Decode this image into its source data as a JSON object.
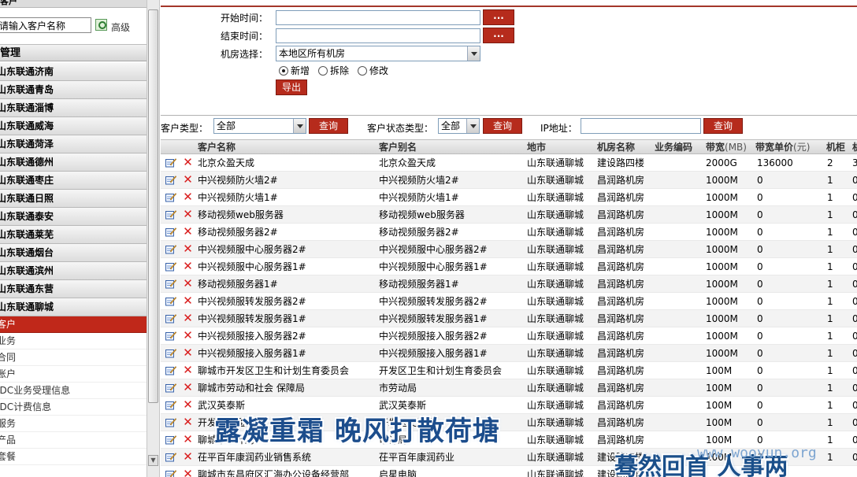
{
  "sidebar": {
    "header": "客户",
    "search_placeholder": "请输入客户名称",
    "advanced_label": "高级",
    "section_title": "管理",
    "cities": [
      "山东联通济南",
      "山东联通青岛",
      "山东联通淄博",
      "山东联通威海",
      "山东联通菏泽",
      "山东联通德州",
      "山东联通枣庄",
      "山东联通日照",
      "山东联通泰安",
      "山东联通莱芜",
      "山东联通烟台",
      "山东联通滨州",
      "山东联通东营",
      "山东联通聊城"
    ],
    "sub_items": [
      {
        "label": "客户",
        "active": true
      },
      {
        "label": "业务",
        "active": false
      },
      {
        "label": "合同",
        "active": false
      },
      {
        "label": "账户",
        "active": false
      },
      {
        "label": "IDC业务受理信息",
        "active": false
      },
      {
        "label": "IDC计费信息",
        "active": false
      },
      {
        "label": "服务",
        "active": false
      },
      {
        "label": "产品",
        "active": false
      },
      {
        "label": "套餐",
        "active": false
      }
    ]
  },
  "form": {
    "start_label": "开始时间：",
    "end_label": "结束时间：",
    "room_label": "机房选择：",
    "room_value": "本地区所有机房",
    "browse_label": "...",
    "radio_options": [
      {
        "label": "新增",
        "checked": true
      },
      {
        "label": "拆除",
        "checked": false
      },
      {
        "label": "修改",
        "checked": false
      }
    ],
    "export_label": "导出"
  },
  "filters": {
    "type_label": "客户类型：",
    "type_value": "全部",
    "status_label": "客户状态类型：",
    "status_value": "全部",
    "ip_label": "IP地址：",
    "query_label": "查询"
  },
  "table": {
    "headers": [
      "客户名称",
      "客户别名",
      "地市",
      "机房名称",
      "业务编码",
      "带宽",
      "带宽单价",
      "机柜",
      "机"
    ],
    "bandwidth_unit": "(MB)",
    "price_unit": "(元)",
    "rows": [
      [
        "北京众盈天成",
        "北京众盈天成",
        "山东联通聊城",
        "建设路四楼",
        "",
        "2000G",
        "136000",
        "2",
        "3"
      ],
      [
        "中兴视频防火墙2#",
        "中兴视频防火墙2#",
        "山东联通聊城",
        "昌润路机房",
        "",
        "1000M",
        "0",
        "1",
        "0"
      ],
      [
        "中兴视频防火墙1#",
        "中兴视频防火墙1#",
        "山东联通聊城",
        "昌润路机房",
        "",
        "1000M",
        "0",
        "1",
        "0"
      ],
      [
        "移动视频web服务器",
        "移动视频web服务器",
        "山东联通聊城",
        "昌润路机房",
        "",
        "1000M",
        "0",
        "1",
        "0"
      ],
      [
        "移动视频服务器2#",
        "移动视频服务器2#",
        "山东联通聊城",
        "昌润路机房",
        "",
        "1000M",
        "0",
        "1",
        "0"
      ],
      [
        "中兴视频服中心服务器2#",
        "中兴视频服中心服务器2#",
        "山东联通聊城",
        "昌润路机房",
        "",
        "1000M",
        "0",
        "1",
        "0"
      ],
      [
        "中兴视频服中心服务器1#",
        "中兴视频服中心服务器1#",
        "山东联通聊城",
        "昌润路机房",
        "",
        "1000M",
        "0",
        "1",
        "0"
      ],
      [
        "移动视频服务器1#",
        "移动视频服务器1#",
        "山东联通聊城",
        "昌润路机房",
        "",
        "1000M",
        "0",
        "1",
        "0"
      ],
      [
        "中兴视频服转发服务器2#",
        "中兴视频服转发服务器2#",
        "山东联通聊城",
        "昌润路机房",
        "",
        "1000M",
        "0",
        "1",
        "0"
      ],
      [
        "中兴视频服转发服务器1#",
        "中兴视频服转发服务器1#",
        "山东联通聊城",
        "昌润路机房",
        "",
        "1000M",
        "0",
        "1",
        "0"
      ],
      [
        "中兴视频服接入服务器2#",
        "中兴视频服接入服务器2#",
        "山东联通聊城",
        "昌润路机房",
        "",
        "1000M",
        "0",
        "1",
        "0"
      ],
      [
        "中兴视频服接入服务器1#",
        "中兴视频服接入服务器1#",
        "山东联通聊城",
        "昌润路机房",
        "",
        "1000M",
        "0",
        "1",
        "0"
      ],
      [
        "聊城市开发区卫生和计划生育委员会",
        "开发区卫生和计划生育委员会",
        "山东联通聊城",
        "昌润路机房",
        "",
        "100M",
        "0",
        "1",
        "0"
      ],
      [
        "聊城市劳动和社会 保障局",
        "市劳动局",
        "山东联通聊城",
        "昌润路机房",
        "",
        "100M",
        "0",
        "1",
        "0"
      ],
      [
        "武汉英泰斯",
        "武汉英泰斯",
        "山东联通聊城",
        "昌润路机房",
        "",
        "100M",
        "0",
        "1",
        "0"
      ],
      [
        "开发区交通局",
        "开发区交通局",
        "山东联通聊城",
        "昌润路机房",
        "",
        "100M",
        "0",
        "1",
        "0"
      ],
      [
        "聊城市审计局",
        "审计局",
        "山东联通聊城",
        "昌润路机房",
        "",
        "100M",
        "0",
        "1",
        "0"
      ],
      [
        "茌平百年康润药业销售系统",
        "茌平百年康润药业",
        "山东联通聊城",
        "建设路四楼",
        "",
        "100M",
        "0",
        "1",
        "0"
      ],
      [
        "聊城市东昌府区汇海办公设备经营部",
        "启星电脑",
        "山东联通聊城",
        "建设路四楼",
        "",
        "",
        "",
        "",
        ""
      ]
    ]
  },
  "watermarks": {
    "main": "露凝重霜  晚风打散荷塘",
    "corner": "蓦然回首  人事两",
    "site": "www.wooyun.org"
  }
}
